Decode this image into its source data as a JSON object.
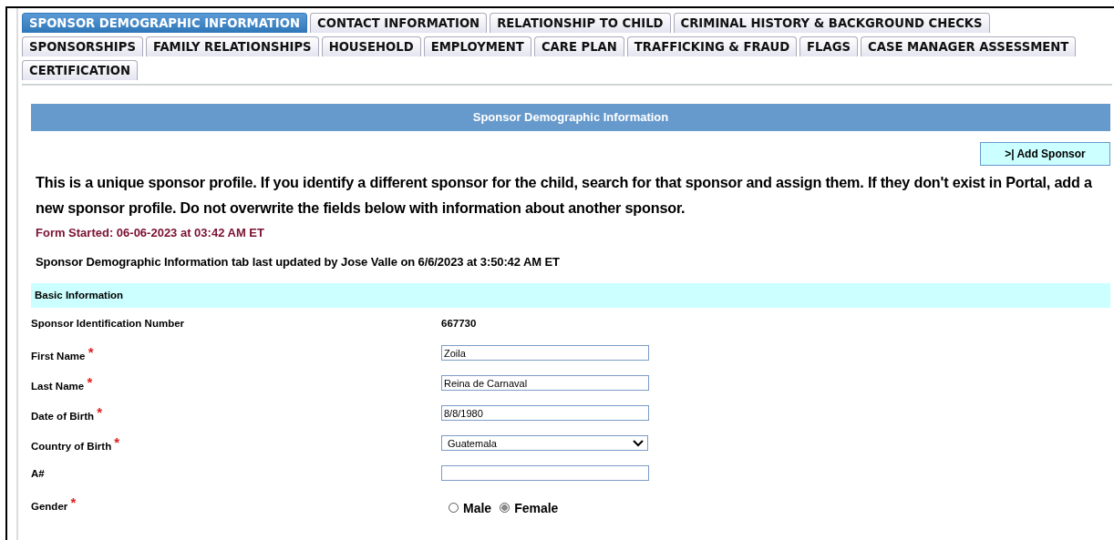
{
  "tab_rows": [
    [
      {
        "label": "SPONSOR DEMOGRAPHIC INFORMATION",
        "selected": true
      },
      {
        "label": "CONTACT INFORMATION",
        "selected": false
      },
      {
        "label": "RELATIONSHIP TO CHILD",
        "selected": false
      },
      {
        "label": "CRIMINAL HISTORY & BACKGROUND CHECKS",
        "selected": false
      }
    ],
    [
      {
        "label": "SPONSORSHIPS",
        "selected": false
      },
      {
        "label": "FAMILY RELATIONSHIPS",
        "selected": false
      },
      {
        "label": "HOUSEHOLD",
        "selected": false
      },
      {
        "label": "EMPLOYMENT",
        "selected": false
      },
      {
        "label": "CARE PLAN",
        "selected": false
      },
      {
        "label": "TRAFFICKING & FRAUD",
        "selected": false
      },
      {
        "label": "FLAGS",
        "selected": false
      },
      {
        "label": "CASE MANAGER ASSESSMENT",
        "selected": false
      }
    ],
    [
      {
        "label": "CERTIFICATION",
        "selected": false
      }
    ]
  ],
  "section_title": "Sponsor Demographic Information",
  "add_button": ">| Add Sponsor",
  "notice": "This is a unique sponsor profile. If you identify a different sponsor for the child, search for that sponsor and assign them. If they don't exist in Portal, add a new sponsor profile. Do not overwrite the fields below with information about another sponsor.",
  "form_started": "Form Started: 06-06-2023 at 03:42 AM ET",
  "last_updated": "Sponsor Demographic Information tab last updated by Jose Valle on 6/6/2023 at 3:50:42 AM ET",
  "subsection_title": "Basic Information",
  "fields": [
    {
      "kind": "readonly",
      "label": "Sponsor Identification Number",
      "value": "667730"
    },
    {
      "kind": "text",
      "label": "First Name",
      "required_mark": "*",
      "value": "Zoila"
    },
    {
      "kind": "text",
      "label": "Last Name",
      "required_mark": "*",
      "value": "Reina de Carnaval"
    },
    {
      "kind": "text",
      "label": "Date of Birth",
      "required_mark": "*",
      "value": "8/8/1980"
    },
    {
      "kind": "select",
      "label": "Country of Birth",
      "required_mark": "*",
      "value": "Guatemala"
    },
    {
      "kind": "text",
      "label": "A#"
    },
    {
      "kind": "radio",
      "label": "Gender",
      "required_mark": "*",
      "options": [
        {
          "label": "Male",
          "selected": false
        },
        {
          "label": "Female",
          "selected": true
        }
      ]
    }
  ]
}
